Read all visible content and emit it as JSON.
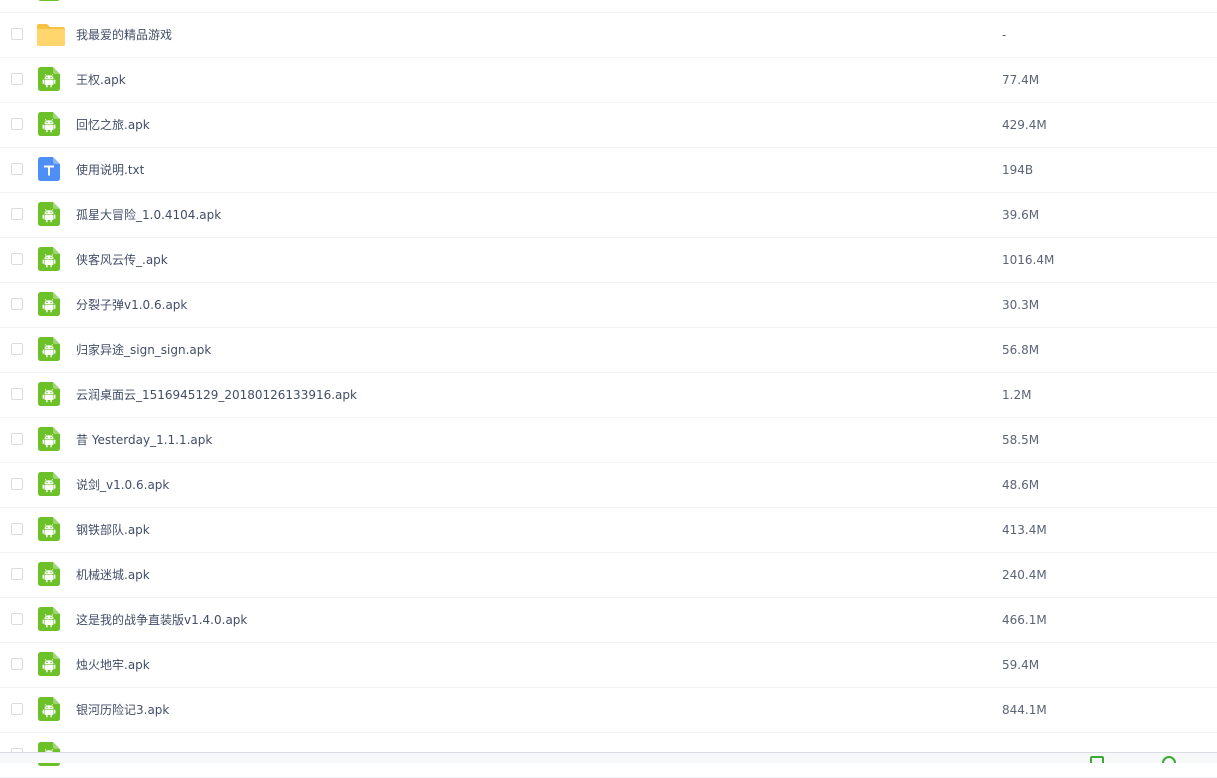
{
  "colors": {
    "android": "#6cc129",
    "folder": "#ffd66e",
    "folder_tab": "#f5c241",
    "txt": "#4e8ef7"
  },
  "files": [
    {
      "name": "",
      "size": "",
      "icon": "android-icon",
      "type": "apk"
    },
    {
      "name": "我最爱的精品游戏",
      "size": "-",
      "icon": "folder-icon",
      "type": "folder"
    },
    {
      "name": "王权.apk",
      "size": "77.4M",
      "icon": "android-icon",
      "type": "apk"
    },
    {
      "name": "回忆之旅.apk",
      "size": "429.4M",
      "icon": "android-icon",
      "type": "apk"
    },
    {
      "name": "使用说明.txt",
      "size": "194B",
      "icon": "text-file-icon",
      "type": "txt"
    },
    {
      "name": "孤星大冒险_1.0.4104.apk",
      "size": "39.6M",
      "icon": "android-icon",
      "type": "apk"
    },
    {
      "name": "侠客风云传_.apk",
      "size": "1016.4M",
      "icon": "android-icon",
      "type": "apk"
    },
    {
      "name": "分裂子弹v1.0.6.apk",
      "size": "30.3M",
      "icon": "android-icon",
      "type": "apk"
    },
    {
      "name": "归家异途_sign_sign.apk",
      "size": "56.8M",
      "icon": "android-icon",
      "type": "apk"
    },
    {
      "name": "云润桌面云_1516945129_20180126133916.apk",
      "size": "1.2M",
      "icon": "android-icon",
      "type": "apk"
    },
    {
      "name": "昔 Yesterday_1.1.1.apk",
      "size": "58.5M",
      "icon": "android-icon",
      "type": "apk"
    },
    {
      "name": "说剑_v1.0.6.apk",
      "size": "48.6M",
      "icon": "android-icon",
      "type": "apk"
    },
    {
      "name": "钢铁部队.apk",
      "size": "413.4M",
      "icon": "android-icon",
      "type": "apk"
    },
    {
      "name": "机械迷城.apk",
      "size": "240.4M",
      "icon": "android-icon",
      "type": "apk"
    },
    {
      "name": "这是我的战争直装版v1.4.0.apk",
      "size": "466.1M",
      "icon": "android-icon",
      "type": "apk"
    },
    {
      "name": "烛火地牢.apk",
      "size": "59.4M",
      "icon": "android-icon",
      "type": "apk"
    },
    {
      "name": "银河历险记3.apk",
      "size": "844.1M",
      "icon": "android-icon",
      "type": "apk"
    },
    {
      "name": "",
      "size": "",
      "icon": "android-icon",
      "type": "apk"
    }
  ],
  "bottom_bar": {
    "items": [
      {
        "label": "",
        "icon": "play-icon"
      },
      {
        "label": "",
        "icon": "circle-icon"
      }
    ]
  }
}
